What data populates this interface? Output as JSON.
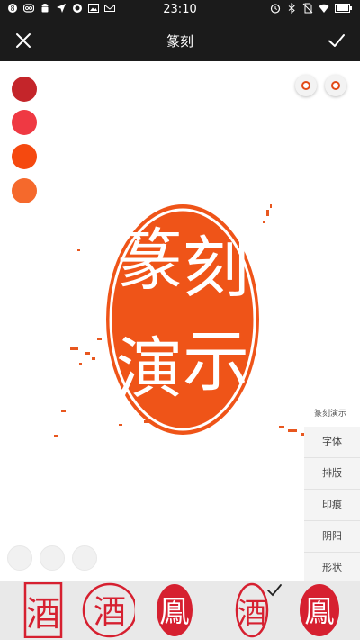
{
  "status_bar": {
    "time": "23:10",
    "left_icons": [
      "notification-badge-icon",
      "infinity-icon",
      "android-icon",
      "navigation-arrow-icon",
      "circle-icon",
      "image-icon",
      "mail-icon"
    ],
    "right_icons": [
      "alarm-clock-icon",
      "bluetooth-icon",
      "no-sim-icon",
      "wifi-icon",
      "battery-icon"
    ]
  },
  "titlebar": {
    "title": "篆刻",
    "close_icon": "close-icon",
    "confirm_icon": "checkmark-icon"
  },
  "palette": {
    "colors": [
      "#c4252a",
      "#ef3943",
      "#f5490f",
      "#f5692c"
    ]
  },
  "mode_toggles": [
    "ring-toggle-icon",
    "ring-toggle-icon"
  ],
  "seal": {
    "characters": [
      "篆",
      "刻",
      "演",
      "示"
    ],
    "fill_color": "#ef5418",
    "shape": "oval"
  },
  "side_panel": {
    "hint": "篆刻演示",
    "items": [
      "字体",
      "排版",
      "印痕",
      "阴阳",
      "形状"
    ]
  },
  "bottom_strip": {
    "thumbnails": [
      {
        "char": "酒",
        "style": "tall rectangle, red outline"
      },
      {
        "char": "酒",
        "style": "circle, red outline"
      },
      {
        "char": "鳯",
        "style": "oval, red fill"
      },
      {
        "char": "酒",
        "style": "tall oval, red outline",
        "selected": true
      },
      {
        "char": "鳯",
        "style": "oval, red fill"
      }
    ],
    "selected_mark_icon": "checkmark-icon"
  }
}
